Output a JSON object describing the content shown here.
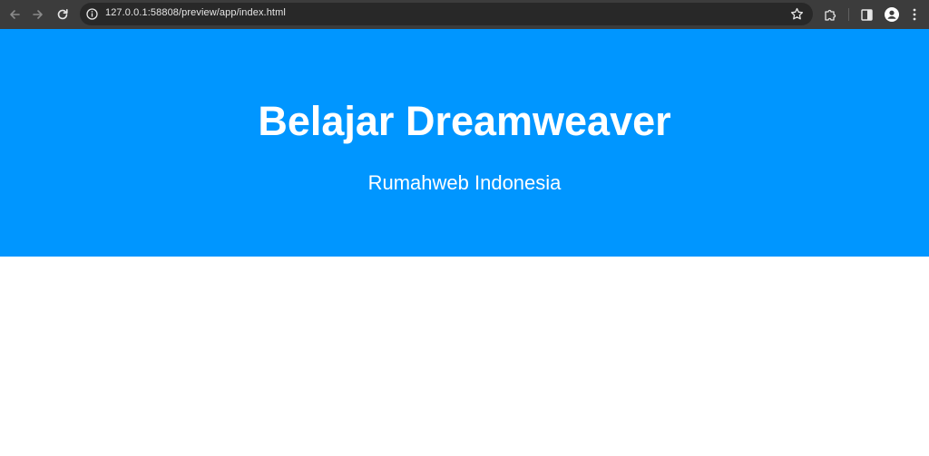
{
  "browser": {
    "url": "127.0.0.1:58808/preview/app/index.html",
    "icons": {
      "back": "back-arrow-icon",
      "forward": "forward-arrow-icon",
      "reload": "reload-icon",
      "site_info": "info-icon",
      "bookmark": "star-icon",
      "extensions": "puzzle-icon",
      "side_panel": "side-panel-icon",
      "profile": "profile-icon",
      "menu": "kebab-menu-icon"
    },
    "colors": {
      "toolbar": "#3c3c3c",
      "omnibox": "#282828"
    }
  },
  "hero": {
    "title": "Belajar Dreamweaver",
    "subtitle": "Rumahweb Indonesia",
    "background": "#0096ff",
    "text_color": "#ffffff"
  }
}
